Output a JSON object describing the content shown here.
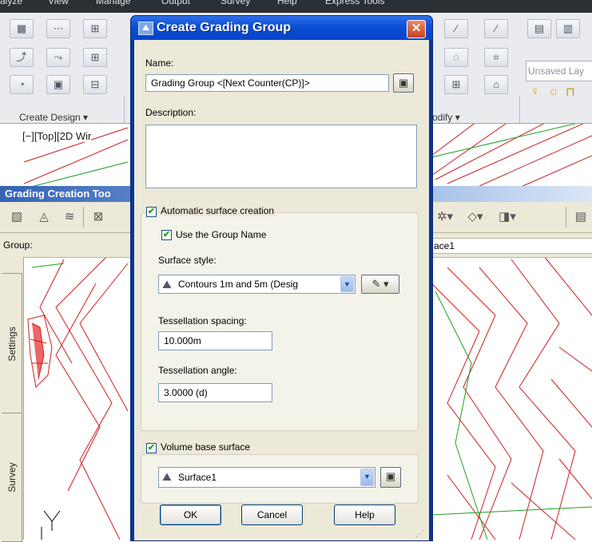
{
  "menubar": {
    "items": [
      "alyze",
      "View",
      "Manage",
      "Output",
      "Survey",
      "Help",
      "Express Tools"
    ]
  },
  "ribbon": {
    "panels": [
      "Create Design",
      "odify"
    ],
    "layer_combo": "Unsaved Lay"
  },
  "viewport": {
    "label": "[−][Top][2D Wir"
  },
  "grading_toolbar": {
    "title": "Grading Creation Too",
    "group_label": "Group:",
    "surface_value": "ace1"
  },
  "side_tabs": [
    "Settings",
    "Survey"
  ],
  "dialog": {
    "title": "Create Grading Group",
    "close_label": "✕",
    "name_label": "Name:",
    "name_value": "Grading Group <[Next Counter(CP)]>",
    "description_label": "Description:",
    "description_value": "",
    "auto_surface": {
      "label": "Automatic surface creation",
      "checked": true,
      "use_group_name_label": "Use the Group Name",
      "use_group_name_checked": true,
      "surface_style_label": "Surface style:",
      "surface_style_value": "Contours 1m and 5m (Desig",
      "tessellation_spacing_label": "Tessellation spacing:",
      "tessellation_spacing_value": "10.000m",
      "tessellation_angle_label": "Tessellation angle:",
      "tessellation_angle_value": "3.0000 (d)"
    },
    "volume_base": {
      "label": "Volume base surface",
      "checked": true,
      "value": "Surface1"
    },
    "buttons": {
      "ok": "OK",
      "cancel": "Cancel",
      "help": "Help"
    }
  },
  "colors": {
    "contour_red": "#cc2020",
    "contour_green": "#20a020",
    "xp_blue": "#0a4ed5",
    "dialog_bg": "#ece9d8"
  }
}
